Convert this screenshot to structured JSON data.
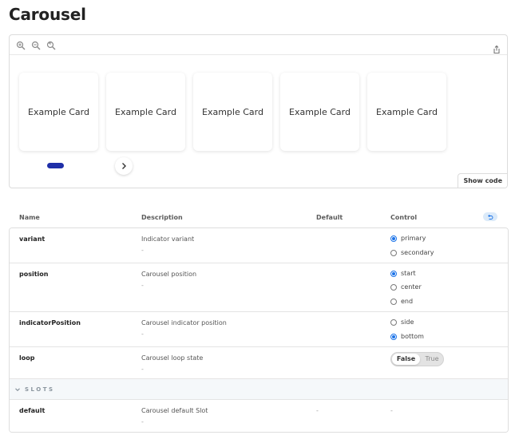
{
  "page": {
    "title": "Carousel"
  },
  "toolbar": {
    "tools": [
      "zoom-in-icon",
      "zoom-out-icon",
      "zoom-reset-icon"
    ],
    "share_icon": "share-icon"
  },
  "carousel": {
    "cards": [
      "Example Card",
      "Example Card",
      "Example Card",
      "Example Card",
      "Example Card"
    ],
    "indicator_color": "#1f2fa8",
    "next_icon": "chevron-right-icon",
    "show_code_label": "Show code"
  },
  "table": {
    "headers": {
      "name": "Name",
      "description": "Description",
      "default": "Default",
      "control": "Control"
    },
    "reset_icon": "undo-icon",
    "rows": [
      {
        "name": "variant",
        "description": "Indicator variant",
        "dash": "-",
        "options": [
          {
            "label": "primary",
            "checked": true
          },
          {
            "label": "secondary",
            "checked": false
          }
        ]
      },
      {
        "name": "position",
        "description": "Carousel position",
        "dash": "-",
        "options": [
          {
            "label": "start",
            "checked": true
          },
          {
            "label": "center",
            "checked": false
          },
          {
            "label": "end",
            "checked": false
          }
        ]
      },
      {
        "name": "indicatorPosition",
        "description": "Carousel indicator position",
        "dash": "-",
        "options": [
          {
            "label": "side",
            "checked": false
          },
          {
            "label": "bottom",
            "checked": true
          }
        ]
      },
      {
        "name": "loop",
        "description": "Carousel loop state",
        "dash": "-",
        "toggle": {
          "on_label": "False",
          "off_label": "True",
          "selected": "False"
        }
      }
    ],
    "slots_section": {
      "label": "SLOTS"
    },
    "slot_rows": [
      {
        "name": "default",
        "description": "Carousel default Slot",
        "dash": "-",
        "default": "-",
        "control": "-"
      }
    ]
  },
  "colors": {
    "accent": "#1b73e8",
    "indicator": "#1f2fa8",
    "reset_bg": "#dbeaf9"
  }
}
